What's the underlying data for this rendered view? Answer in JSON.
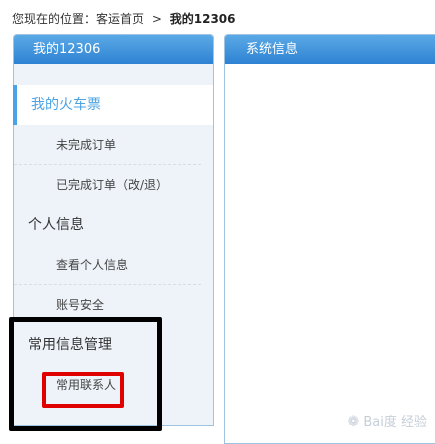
{
  "breadcrumb": {
    "prefix": "您现在的位置：",
    "home": "客运首页",
    "separator": ">",
    "current": "我的12306"
  },
  "left_panel": {
    "title": "我的12306",
    "menu": [
      {
        "label": "我的火车票",
        "kind": "group",
        "active": true
      },
      {
        "label": "未完成订单",
        "kind": "sub"
      },
      {
        "label": "已完成订单（改/退）",
        "kind": "sub"
      },
      {
        "label": "个人信息",
        "kind": "group"
      },
      {
        "label": "查看个人信息",
        "kind": "sub"
      },
      {
        "label": "账号安全",
        "kind": "sub"
      },
      {
        "label": "常用信息管理",
        "kind": "group"
      },
      {
        "label": "常用联系人",
        "kind": "sub"
      }
    ]
  },
  "right_panel": {
    "title": "系统信息"
  },
  "watermark": {
    "text": "Bai度 经验"
  },
  "colors": {
    "header_blue": "#2d82d2",
    "active_blue": "#4aa3e4",
    "highlight_red": "#e00000",
    "highlight_black": "#000000"
  }
}
